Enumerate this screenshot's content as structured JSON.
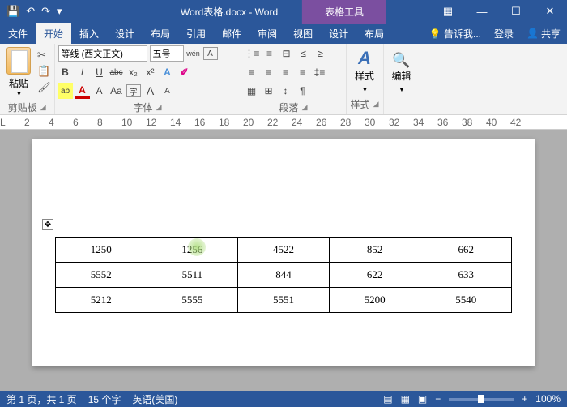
{
  "title": {
    "doc": "Word表格.docx - Word",
    "context": "表格工具"
  },
  "qat": {
    "save": "💾",
    "undo": "↶",
    "redo": "↷",
    "more": "▾"
  },
  "win": {
    "grid": "▦",
    "min": "—",
    "max": "☐",
    "close": "✕"
  },
  "tabs": {
    "file": "文件",
    "home": "开始",
    "insert": "插入",
    "design": "设计",
    "layout": "布局",
    "ref": "引用",
    "mail": "邮件",
    "review": "审阅",
    "view": "视图",
    "tdesign": "设计",
    "tlayout": "布局",
    "tell": "告诉我...",
    "login": "登录",
    "share": "共享"
  },
  "ribbon": {
    "clipboard": {
      "paste": "粘贴",
      "label": "剪贴板",
      "cut": "✂",
      "copy": "📋",
      "painter": "🖌"
    },
    "font": {
      "name": "等线 (西文正文)",
      "size": "五号",
      "grow": "A",
      "shrink": "A",
      "pinyin": "wén",
      "clear": "A",
      "bold": "B",
      "italic": "I",
      "underline": "U",
      "strike": "abc",
      "sub": "x₂",
      "sup": "x²",
      "effects": "A",
      "highlight": "ab",
      "color": "A",
      "char": "A",
      "case": "Aa",
      "circled": "字",
      "border": "A",
      "label": "字体"
    },
    "para": {
      "label": "段落"
    },
    "styles": {
      "label": "样式",
      "btn": "样式",
      "icon": "A"
    },
    "edit": {
      "label": "编辑",
      "find": "🔍"
    }
  },
  "ruler": [
    "2",
    "4",
    "6",
    "8",
    "10",
    "12",
    "14",
    "16",
    "18",
    "20",
    "22",
    "24",
    "26",
    "28",
    "30",
    "32",
    "34",
    "36",
    "38",
    "40",
    "42"
  ],
  "table": [
    [
      "1250",
      "1256",
      "4522",
      "852",
      "662"
    ],
    [
      "5552",
      "5511",
      "844",
      "622",
      "633"
    ],
    [
      "5212",
      "5555",
      "5551",
      "5200",
      "5540"
    ]
  ],
  "status": {
    "page": "第 1 页，共 1 页",
    "words": "15 个字",
    "lang": "英语(美国)",
    "zoom": "100%",
    "minus": "−",
    "plus": "+"
  }
}
